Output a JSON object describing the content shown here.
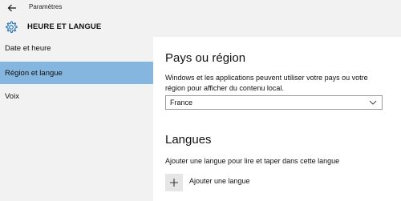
{
  "window": {
    "title": "Paramètres"
  },
  "header": {
    "section_title": "HEURE ET LANGUE",
    "icon": "gear-icon"
  },
  "sidebar": {
    "items": [
      {
        "label": "Date et heure",
        "selected": false
      },
      {
        "label": "Région et langue",
        "selected": true
      },
      {
        "label": "Voix",
        "selected": false
      }
    ]
  },
  "main": {
    "region": {
      "heading": "Pays ou région",
      "description_line1": "Windows et les applications peuvent utiliser votre pays ou votre",
      "description_line2": "région pour afficher du contenu local.",
      "selected_country": "France"
    },
    "languages": {
      "heading": "Langues",
      "description": "Ajouter une langue pour lire et taper dans cette langue",
      "add_label": "Ajouter une langue"
    }
  },
  "colors": {
    "selected_nav": "#84b6df",
    "sidebar_bg": "#f2f2f2"
  }
}
